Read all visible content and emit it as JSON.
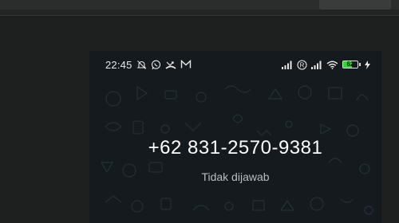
{
  "status_bar": {
    "time": "22:45",
    "left_icons": [
      "muted-bell-icon",
      "whatsapp-icon",
      "missed-call-icon",
      "gmail-icon"
    ],
    "right_icons": [
      "signal-icon",
      "roaming-r-icon",
      "signal-icon",
      "wifi-icon",
      "battery-icon",
      "charging-icon"
    ],
    "battery_level": "62",
    "battery_fraction": 0.62,
    "battery_color": "#3ad13a"
  },
  "call": {
    "number": "+62 831-2570-9381",
    "status": "Tidak dijawab"
  },
  "colors": {
    "phone_background": "#141a1e",
    "desktop_background": "#1e1f1f",
    "status_text": "#b9bdbf"
  }
}
